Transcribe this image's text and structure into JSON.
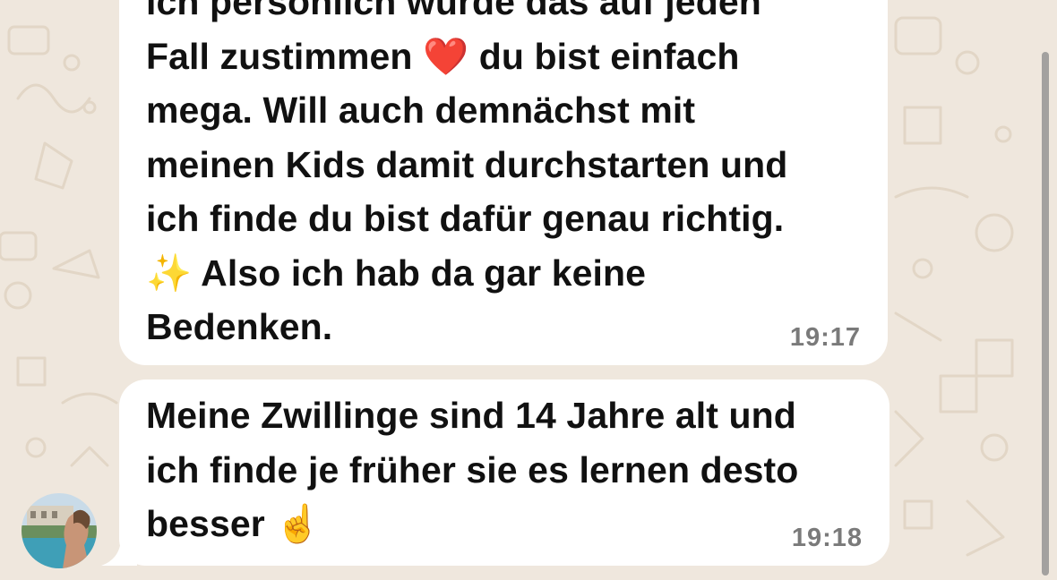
{
  "messages": [
    {
      "text": "ich persönlich würde das auf jeden\nFall zustimmen ❤️ du bist einfach\nmega. Will auch demnächst mit\nmeinen Kids damit durchstarten und\nich finde du bist dafür genau richtig.\n✨ Also ich hab da gar keine\nBedenken.",
      "time": "19:17"
    },
    {
      "text": "Meine Zwillinge sind 14 Jahre alt und\nich finde je früher sie es lernen desto\nbesser ☝️",
      "time": "19:18"
    }
  ],
  "colors": {
    "background": "#efe7dd",
    "bubble": "#ffffff",
    "timestamp": "#7a7a7a"
  },
  "icons": {
    "avatar": "contact-avatar-photo",
    "background_pattern": "chat-doodle-wallpaper"
  }
}
